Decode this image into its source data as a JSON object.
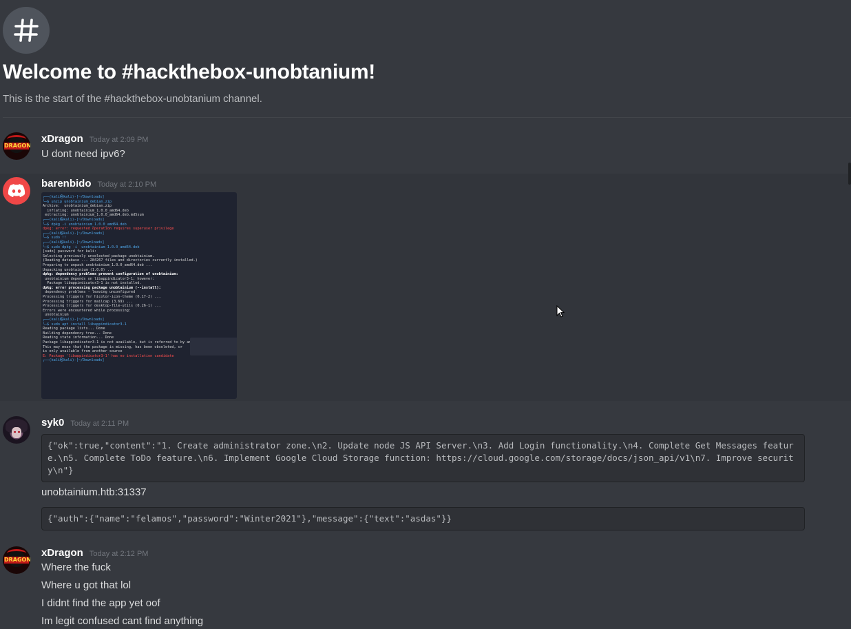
{
  "channel": {
    "welcome_title": "Welcome to #hackthebox-unobtanium!",
    "welcome_subtitle": "This is the start of the #hackthebox-unobtanium channel."
  },
  "messages": [
    {
      "author": "xDragon",
      "timestamp": "Today at 2:09 PM",
      "lines": [
        "U dont need ipv6?"
      ]
    },
    {
      "author": "barenbido",
      "timestamp": "Today at 2:10 PM",
      "attachment": {
        "terminal_lines": [
          "┌──(kali㉿kali)-[~/Downloads]",
          "└─$ unzip unobtainium_debian.zip",
          "Archive:  unobtainium_debian.zip",
          "  inflating: unobtainium_1.0.0_amd64.deb",
          " extracting: unobtainium_1.0.0_amd64.deb.md5sum",
          "",
          "┌──(kali㉿kali)-[~/Downloads]",
          "└─$ dpkg -i unobtainium_1.0.0_amd64.deb",
          "dpkg: error: requested operation requires superuser privilege",
          "",
          "┌──(kali㉿kali)-[~/Downloads]",
          "└─$ sudo !!",
          "",
          "┌──(kali㉿kali)-[~/Downloads]",
          "└─$ sudo dpkg -i  unobtainium_1.0.0_amd64.deb",
          "[sudo] password for kali:",
          "Selecting previously unselected package unobtainium.",
          "(Reading database ... 284267 files and directories currently installed.)",
          "Preparing to unpack unobtainium_1.0.0_amd64.deb ...",
          "Unpacking unobtainium (1.0.0) ...",
          "dpkg: dependency problems prevent configuration of unobtainium:",
          " unobtainium depends on libappindicator3-1; however:",
          "  Package libappindicator3-1 is not installed.",
          "",
          "dpkg: error processing package unobtainium (--install):",
          " dependency problems - leaving unconfigured",
          "Processing triggers for hicolor-icon-theme (0.17-2) ...",
          "Processing triggers for mailcap (3.69) ...",
          "Processing triggers for desktop-file-utils (0.26-1) ...",
          "Errors were encountered while processing:",
          " unobtainium",
          "",
          "┌──(kali㉿kali)-[~/Downloads]",
          "└─$ sudo apt install libappindicator3-1",
          "Reading package lists... Done",
          "Building dependency tree... Done",
          "Reading state information... Done",
          "Package libappindicator3-1 is not available, but is referred to by another package.",
          "This may mean that the package is missing, has been obsoleted, or",
          "is only available from another source",
          "",
          "E: Package 'libappindicator3-1' has no installation candidate",
          "",
          "┌──(kali㉿kali)-[~/Downloads]"
        ]
      }
    },
    {
      "author": "syk0",
      "timestamp": "Today at 2:11 PM",
      "code_1": "{\"ok\":true,\"content\":\"1. Create administrator zone.\\n2. Update node JS API Server.\\n3. Add Login functionality.\\n4. Complete Get Messages feature.\\n5. Complete ToDo feature.\\n6. Implement Google Cloud Storage function: https://cloud.google.com/storage/docs/json_api/v1\\n7. Improve security\\n\"}",
      "line": "unobtainium.htb:31337",
      "code_2": "{\"auth\":{\"name\":\"felamos\",\"password\":\"Winter2021\"},\"message\":{\"text\":\"asdas\"}}"
    },
    {
      "author": "xDragon",
      "timestamp": "Today at 2:12 PM",
      "lines": [
        "Where the fuck",
        "Where u got that lol",
        "I didnt find the app yet oof",
        "Im legit confused cant find anything"
      ]
    }
  ],
  "avatar_text": {
    "dragon": "DRAGON"
  },
  "colors": {
    "background": "#36393f",
    "hover_background": "#32353b",
    "code_background": "#2f3136",
    "discord_avatar": "#f04747"
  }
}
